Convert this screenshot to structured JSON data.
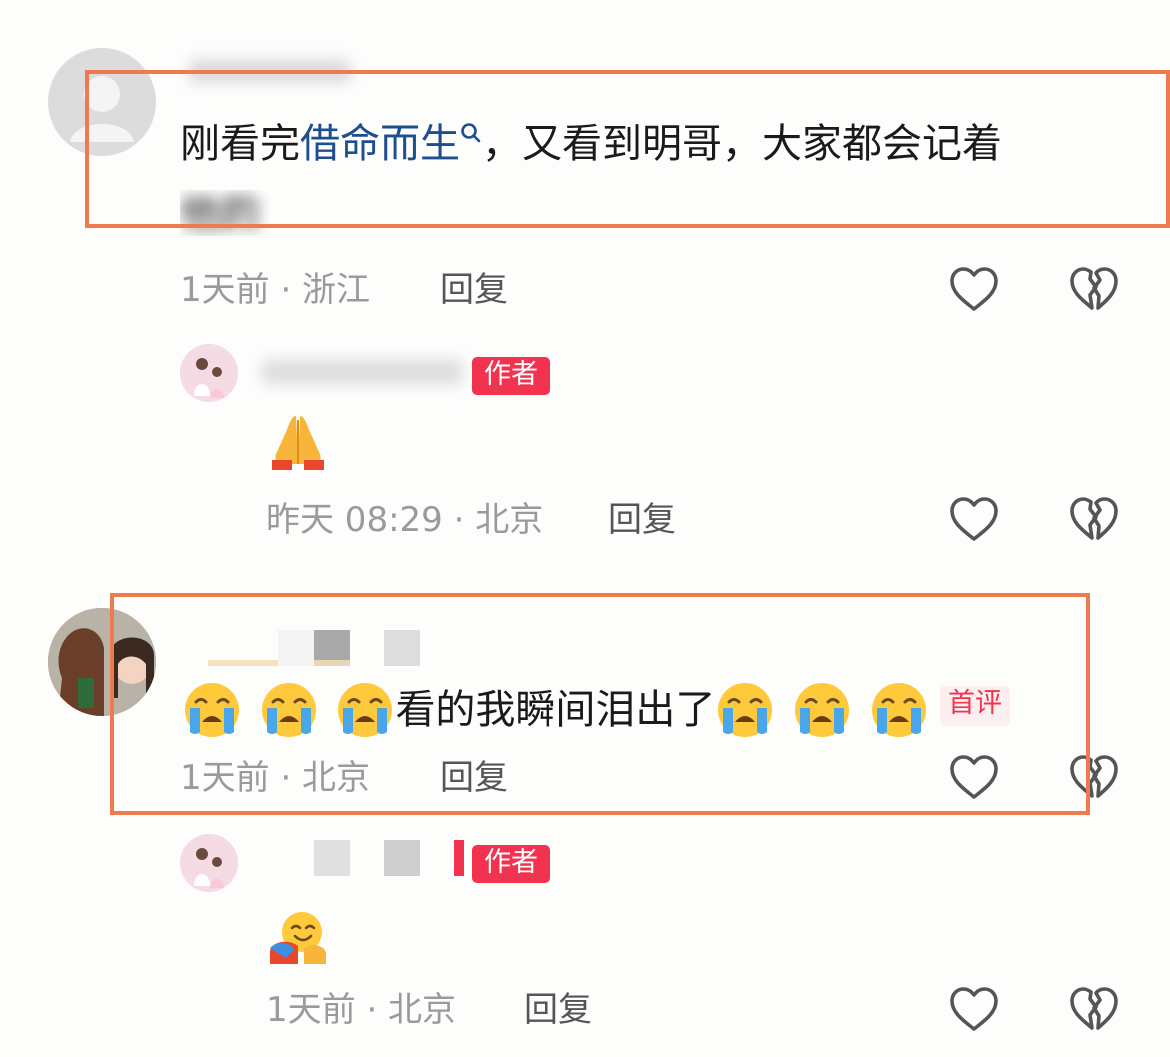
{
  "comments": [
    {
      "text_plain": "刚看完",
      "text_link": "借命而生",
      "text_rest": "，又看到明哥，大家都会记着",
      "text_line2": "他的",
      "meta": "1天前 · 浙江",
      "reply_label": "回复",
      "reply": {
        "badge": "作者",
        "emoji": "folded-hands",
        "meta": "昨天 08:29 · 北京",
        "reply_label": "回复"
      }
    },
    {
      "text_before": "看的我瞬间泪出了",
      "emoji": "loudly-crying-face",
      "badge": "首评",
      "meta": "1天前 · 北京",
      "reply_label": "回复",
      "reply": {
        "badge": "作者",
        "emoji": "hugging-face",
        "meta": "1天前 · 北京",
        "reply_label": "回复"
      }
    }
  ],
  "colors": {
    "link": "#1f4e8f",
    "author_badge": "#f2334f",
    "highlight_box": "#ef7a4e",
    "meta_text": "#9a9a9a"
  }
}
